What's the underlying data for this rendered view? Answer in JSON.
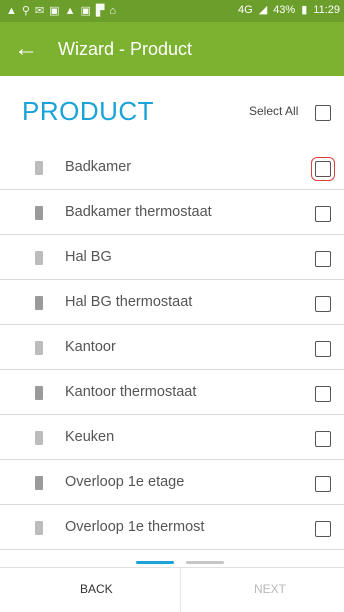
{
  "status_bar": {
    "network": "4G",
    "battery": "43%",
    "time": "11:29",
    "icons_left": [
      "warning-icon",
      "wifi-icon",
      "mail-icon",
      "gallery-icon",
      "warning-icon",
      "media-icon",
      "flag-icon",
      "android-icon"
    ]
  },
  "app_bar": {
    "title": "Wizard - Product"
  },
  "section": {
    "title": "PRODUCT",
    "select_all": "Select All"
  },
  "items": [
    {
      "label": "Badkamer",
      "checked": false,
      "focused": true
    },
    {
      "label": "Badkamer thermostaat",
      "checked": false
    },
    {
      "label": "Hal BG",
      "checked": false
    },
    {
      "label": "Hal BG thermostaat",
      "checked": false
    },
    {
      "label": "Kantoor",
      "checked": false
    },
    {
      "label": "Kantoor thermostaat",
      "checked": false
    },
    {
      "label": "Keuken",
      "checked": false
    },
    {
      "label": "Overloop 1e etage",
      "checked": false
    },
    {
      "label": "Overloop 1e thermost",
      "checked": false
    }
  ],
  "footer": {
    "back": "BACK",
    "next": "NEXT",
    "pages": 2,
    "current_page": 1
  },
  "colors": {
    "status_bar": "#6b9e2a",
    "app_bar": "#7cb230",
    "title": "#1aa3d8",
    "focus": "#e0403c"
  }
}
